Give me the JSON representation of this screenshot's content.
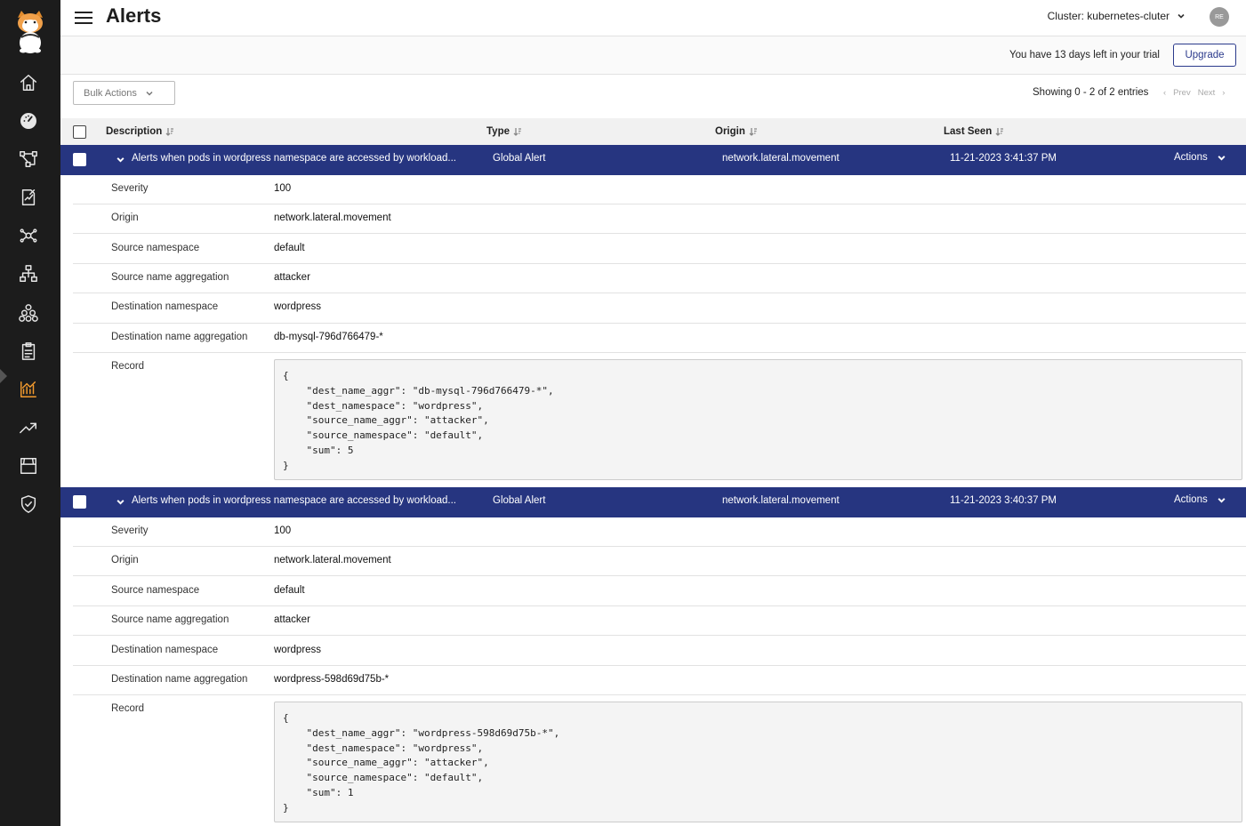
{
  "header": {
    "title": "Alerts",
    "cluster_label": "Cluster: kubernetes-cluter",
    "avatar_initials": "RE"
  },
  "trial": {
    "message": "You have 13 days left in your trial",
    "upgrade_label": "Upgrade"
  },
  "toolbar": {
    "bulk_actions_label": "Bulk Actions",
    "showing_text": "Showing 0 - 2 of 2 entries",
    "prev_label": "Prev",
    "next_label": "Next"
  },
  "table": {
    "columns": [
      "Description",
      "Type",
      "Origin",
      "Last Seen"
    ],
    "actions_label": "Actions",
    "alerts": [
      {
        "description": "Alerts when pods in wordpress namespace are accessed by workload...",
        "type": "Global Alert",
        "origin": "network.lateral.movement",
        "last_seen": "11-21-2023 3:41:37 PM",
        "details": [
          {
            "key": "Severity",
            "value": "100"
          },
          {
            "key": "Origin",
            "value": "network.lateral.movement"
          },
          {
            "key": "Source namespace",
            "value": "default"
          },
          {
            "key": "Source name aggregation",
            "value": "attacker"
          },
          {
            "key": "Destination namespace",
            "value": "wordpress"
          },
          {
            "key": "Destination name aggregation",
            "value": "db-mysql-796d766479-*"
          }
        ],
        "record_label": "Record",
        "record": "{\n    \"dest_name_aggr\": \"db-mysql-796d766479-*\",\n    \"dest_namespace\": \"wordpress\",\n    \"source_name_aggr\": \"attacker\",\n    \"source_namespace\": \"default\",\n    \"sum\": 5\n}"
      },
      {
        "description": "Alerts when pods in wordpress namespace are accessed by workload...",
        "type": "Global Alert",
        "origin": "network.lateral.movement",
        "last_seen": "11-21-2023 3:40:37 PM",
        "details": [
          {
            "key": "Severity",
            "value": "100"
          },
          {
            "key": "Origin",
            "value": "network.lateral.movement"
          },
          {
            "key": "Source namespace",
            "value": "default"
          },
          {
            "key": "Source name aggregation",
            "value": "attacker"
          },
          {
            "key": "Destination namespace",
            "value": "wordpress"
          },
          {
            "key": "Destination name aggregation",
            "value": "wordpress-598d69d75b-*"
          }
        ],
        "record_label": "Record",
        "record": "{\n    \"dest_name_aggr\": \"wordpress-598d69d75b-*\",\n    \"dest_namespace\": \"wordpress\",\n    \"source_name_aggr\": \"attacker\",\n    \"source_namespace\": \"default\",\n    \"sum\": 1\n}"
      }
    ]
  },
  "sidebar": {
    "icons": [
      "home-icon",
      "dashboard-icon",
      "service-graph-icon",
      "policies-icon",
      "endpoints-icon",
      "network-icon",
      "cluster-icon",
      "compliance-icon",
      "alerts-icon",
      "activity-icon",
      "image-assurance-icon",
      "security-icon"
    ],
    "active_index": 8,
    "active_color": "#f29a2e"
  },
  "colors": {
    "alert_row_bg": "#263580",
    "sidebar_bg": "#1c1c1c"
  }
}
